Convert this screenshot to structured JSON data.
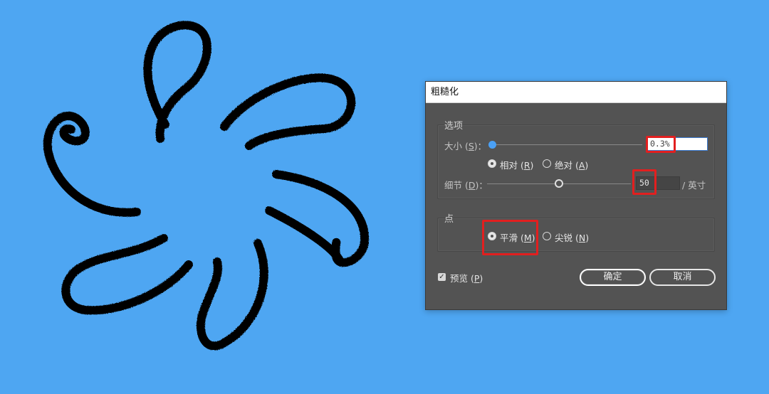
{
  "dialog": {
    "title": "粗糙化",
    "options_group": {
      "title": "选项",
      "size": {
        "label": "大小 (",
        "hotkey": "S",
        "label_tail": ")：",
        "value": "0.3%"
      },
      "mode": {
        "relative_label": "相对 (",
        "relative_hotkey": "R",
        "relative_tail": ")",
        "absolute_label": "绝对 (",
        "absolute_hotkey": "A",
        "absolute_tail": ")",
        "selected": "relative"
      },
      "detail": {
        "label": "细节 (",
        "hotkey": "D",
        "label_tail": ")：",
        "value": "50",
        "unit": "/ 英寸"
      }
    },
    "points_group": {
      "title": "点",
      "smooth_label": "平滑 (",
      "smooth_hotkey": "M",
      "smooth_tail": ")",
      "corner_label": "尖锐 (",
      "corner_hotkey": "N",
      "corner_tail": ")",
      "selected": "smooth"
    },
    "preview": {
      "label": "预览 (",
      "hotkey": "P",
      "tail": ")",
      "checked": true
    },
    "ok_label": "确定",
    "cancel_label": "取消"
  },
  "colors": {
    "canvas_background": "#4ea6f2",
    "dialog_background": "#535353",
    "slider_accent": "#4aa0f5",
    "highlight": "#e21f1f",
    "stroke": "#000000"
  },
  "sliders": {
    "size_fraction": 0.003,
    "detail_fraction": 0.5
  }
}
